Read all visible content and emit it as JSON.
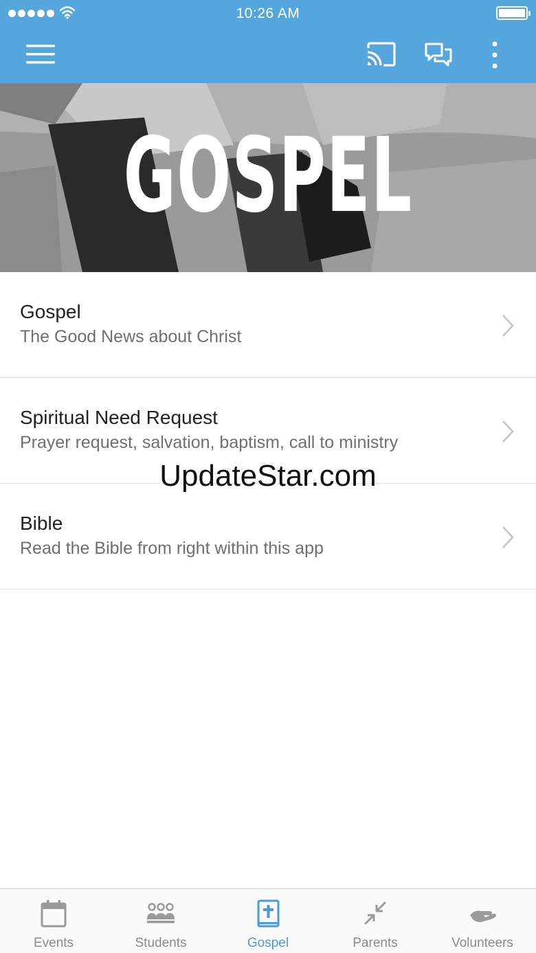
{
  "colors": {
    "header_bg": "#56a6de",
    "accent": "#4a9ad6",
    "inactive_tab": "#8a8a8a"
  },
  "status_bar": {
    "time": "10:26 AM"
  },
  "header": {
    "icons": [
      "menu-icon",
      "cast-icon",
      "chat-icon",
      "more-vertical-icon"
    ]
  },
  "hero": {
    "title": "GOSPEL"
  },
  "list": {
    "items": [
      {
        "title": "Gospel",
        "subtitle": "The Good News about Christ"
      },
      {
        "title": "Spiritual Need Request",
        "subtitle": "Prayer request, salvation, baptism, call to ministry"
      },
      {
        "title": "Bible",
        "subtitle": "Read the Bible from right within this app"
      }
    ]
  },
  "watermark": "UpdateStar.com",
  "tabs": [
    {
      "label": "Events",
      "icon": "calendar-icon",
      "active": false
    },
    {
      "label": "Students",
      "icon": "people-icon",
      "active": false
    },
    {
      "label": "Gospel",
      "icon": "bible-icon",
      "active": true
    },
    {
      "label": "Parents",
      "icon": "arrows-in-icon",
      "active": false
    },
    {
      "label": "Volunteers",
      "icon": "helping-hand-icon",
      "active": false
    }
  ]
}
